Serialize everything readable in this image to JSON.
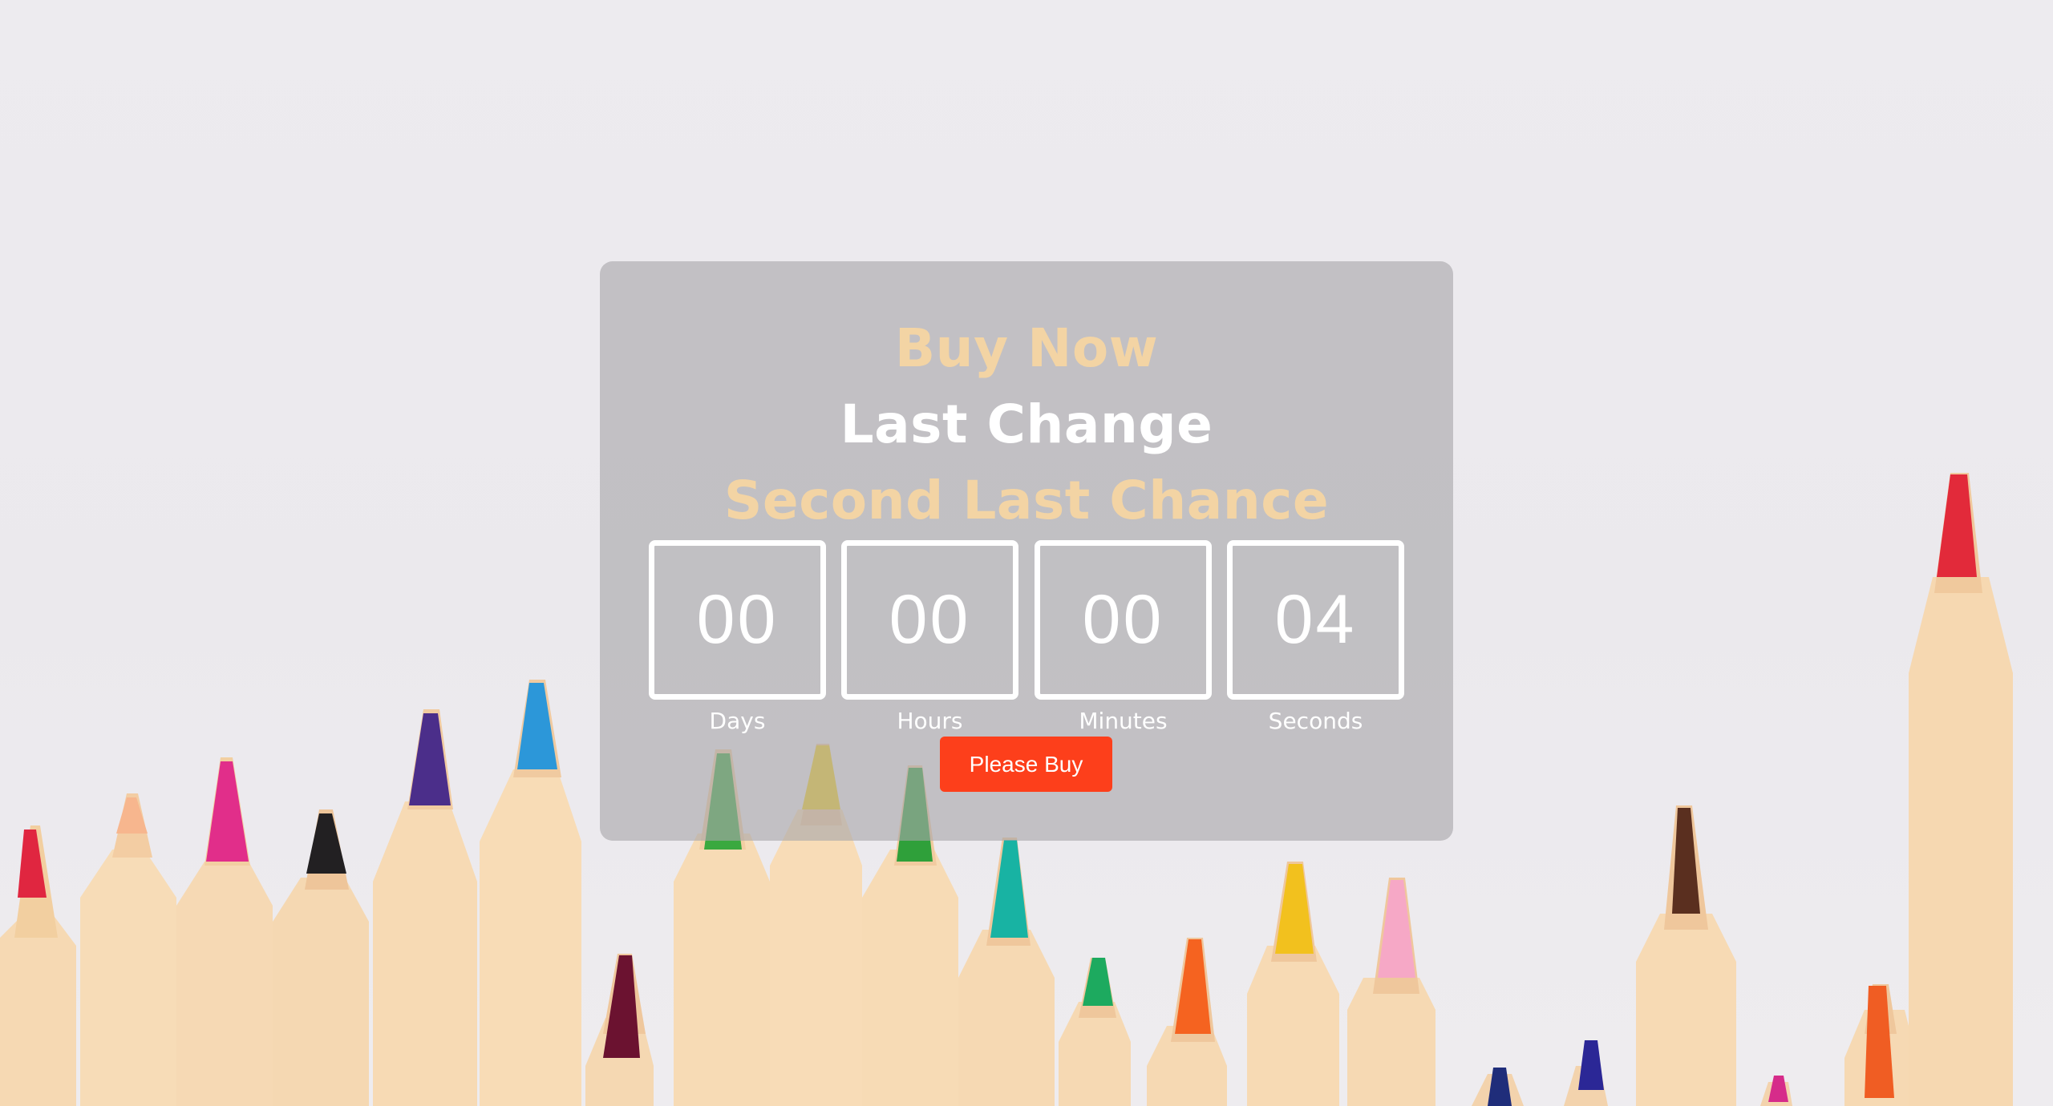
{
  "headline": {
    "line1": "Buy Now",
    "line2": "Last Change",
    "line3": "Second Last Chance"
  },
  "countdown": [
    {
      "value": "00",
      "label": "Days"
    },
    {
      "value": "00",
      "label": "Hours"
    },
    {
      "value": "00",
      "label": "Minutes"
    },
    {
      "value": "04",
      "label": "Seconds"
    }
  ],
  "cta": {
    "label": "Please Buy"
  },
  "colors": {
    "accent_text": "#f3d4a4",
    "button": "#fd3f1b",
    "card_overlay": "rgba(168,166,170,0.62)",
    "background": "#eceaee"
  }
}
